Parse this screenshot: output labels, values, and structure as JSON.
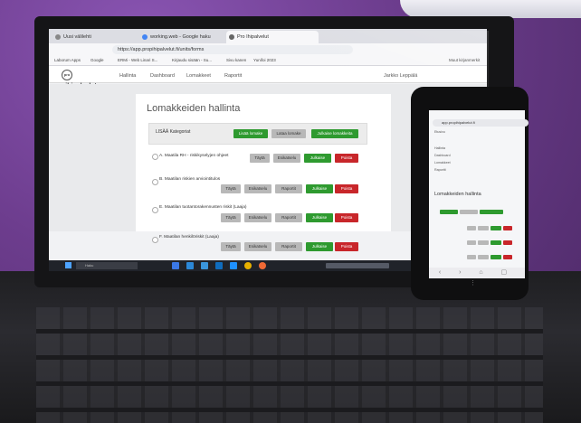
{
  "browser": {
    "tabs": [
      {
        "label": "Uusi välilehti"
      },
      {
        "label": "working.web - Google haku"
      },
      {
        "label": "Pro Ihipalvelut"
      }
    ],
    "url": "https://app.propihipalvelut.fi/units/forms",
    "bookmarks": [
      "Laborum Apps",
      "Google",
      "ERMi - Web Linari S...",
      "Kirjaudu sisään - Su...",
      "Sivu kanen",
      "Yunifoi 2023",
      "Muut kirjanmerkit"
    ]
  },
  "app": {
    "logo_mark": "pro",
    "logo_text": "pihipalvelut",
    "nav": [
      "Hallinta",
      "Dashboard",
      "Lomakkeet",
      "Raportit"
    ],
    "user": "Jarkko Leppälä",
    "page_title": "Lomakkeiden hallinta",
    "toolbar": {
      "category_label": "LISÄÄ Kategoriat",
      "add_form": "Lisää lomake",
      "import_form": "Lataa lomake",
      "publish_forms": "Julkaise lomakkeita"
    },
    "rows": [
      {
        "label": "A. Maatila RH - riskikyselyjen ohjeet",
        "buttons": [
          "Täytä",
          "Esikatselu",
          "Julkaise",
          "Poista"
        ]
      },
      {
        "label": "B. Maatilan riskien arviointitulos",
        "buttons": [
          "Täytä",
          "Esikatselu",
          "Raportit",
          "Julkaise",
          "Poista"
        ]
      },
      {
        "label": "E. Maatilan tuotantorakennusten riskit (Laaja)",
        "buttons": [
          "Täytä",
          "Esikatselu",
          "Raportit",
          "Julkaise",
          "Poista"
        ]
      },
      {
        "label": "F. Maatilan henkilöriskit (Laaja)",
        "buttons": [
          "Täytä",
          "Esikatselu",
          "Raportit",
          "Julkaise",
          "Poista"
        ]
      }
    ]
  },
  "taskbar": {
    "search": "Haku"
  },
  "phone": {
    "url": "app.propihipalvelut.fi",
    "menu": [
      "Etusivu",
      "Hallinta",
      "Dashboard",
      "Lomakkeet",
      "Raportit"
    ],
    "page_title": "Lomakkeiden hallinta",
    "nav_glyphs": "‹ › ⌂ ▢ ⋮"
  },
  "colors": {
    "wall": "#6d3d8e",
    "green_button": "#2e9a2f",
    "red_button": "#c8262a",
    "grey_button": "#b8b8b8"
  }
}
